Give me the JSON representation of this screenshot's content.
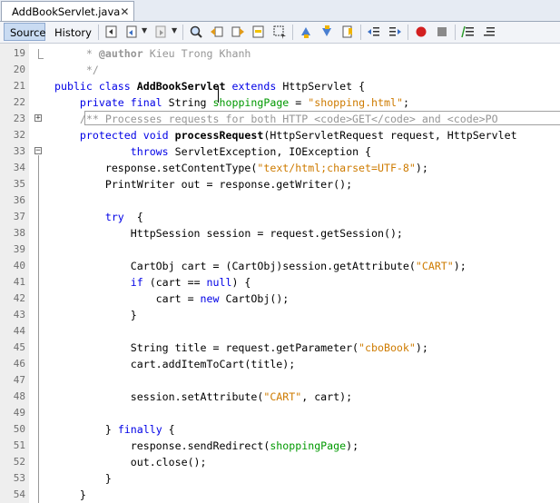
{
  "tab": {
    "title": "AddBookServlet.java",
    "close": "✕"
  },
  "toolbar": {
    "source_label": "Source",
    "history_label": "History",
    "icons": [
      "last-edit-icon",
      "back-icon",
      "forward-icon",
      "find-icon",
      "find-previous-icon",
      "find-next-icon",
      "toggle-highlight-icon",
      "toggle-rectangular-selection-icon",
      "previous-bookmark-icon",
      "next-bookmark-icon",
      "toggle-bookmark-icon",
      "shift-left-icon",
      "shift-right-icon",
      "start-macro-icon",
      "stop-macro-icon",
      "comment-icon",
      "uncomment-icon"
    ]
  },
  "lines": [
    {
      "n": "19",
      "segs": [
        [
          "cm",
          "     * "
        ],
        [
          "cmtag",
          "@author"
        ],
        [
          "cm",
          " Kieu Trong Khanh"
        ]
      ]
    },
    {
      "n": "20",
      "segs": [
        [
          "cm",
          "     */"
        ]
      ]
    },
    {
      "n": "21",
      "segs": [
        [
          "kw",
          "public class "
        ],
        [
          "bold",
          "AddBookServlet"
        ],
        [
          "kw",
          " extends "
        ],
        [
          "",
          "HttpServlet {"
        ]
      ]
    },
    {
      "n": "22",
      "segs": [
        [
          "",
          "    "
        ],
        [
          "kw",
          "private final "
        ],
        [
          "",
          "String "
        ],
        [
          "fld",
          "shoppingPage"
        ],
        [
          "",
          " = "
        ],
        [
          "str",
          "\"shopping.html\""
        ],
        [
          "",
          ";"
        ]
      ]
    },
    {
      "n": "23",
      "segs": [
        [
          "cm",
          "    /** Processes requests for both HTTP <code>GET</code> and <code>PO"
        ]
      ]
    },
    {
      "n": "32",
      "segs": [
        [
          "",
          "    "
        ],
        [
          "kw",
          "protected void "
        ],
        [
          "bold",
          "processRequest"
        ],
        [
          "",
          "(HttpServletRequest request, HttpServlet"
        ]
      ]
    },
    {
      "n": "33",
      "segs": [
        [
          "",
          "            "
        ],
        [
          "kw",
          "throws "
        ],
        [
          "",
          "ServletException, IOException {"
        ]
      ]
    },
    {
      "n": "34",
      "segs": [
        [
          "",
          "        response.setContentType("
        ],
        [
          "str",
          "\"text/html;charset=UTF-8\""
        ],
        [
          "",
          ");"
        ]
      ]
    },
    {
      "n": "35",
      "segs": [
        [
          "",
          "        PrintWriter out = response.getWriter();"
        ]
      ]
    },
    {
      "n": "36",
      "segs": []
    },
    {
      "n": "37",
      "segs": [
        [
          "",
          "        "
        ],
        [
          "kw",
          "try"
        ],
        [
          "",
          "  {"
        ]
      ]
    },
    {
      "n": "38",
      "segs": [
        [
          "",
          "            HttpSession session = request.getSession();"
        ]
      ]
    },
    {
      "n": "39",
      "segs": []
    },
    {
      "n": "40",
      "segs": [
        [
          "",
          "            CartObj cart = (CartObj)session.getAttribute("
        ],
        [
          "str",
          "\"CART\""
        ],
        [
          "",
          ");"
        ]
      ]
    },
    {
      "n": "41",
      "segs": [
        [
          "",
          "            "
        ],
        [
          "kw",
          "if"
        ],
        [
          "",
          " (cart == "
        ],
        [
          "kw",
          "null"
        ],
        [
          "",
          ") {"
        ]
      ]
    },
    {
      "n": "42",
      "segs": [
        [
          "",
          "                cart = "
        ],
        [
          "kw",
          "new"
        ],
        [
          "",
          " CartObj();"
        ]
      ]
    },
    {
      "n": "43",
      "segs": [
        [
          "",
          "            }"
        ]
      ]
    },
    {
      "n": "44",
      "segs": []
    },
    {
      "n": "45",
      "segs": [
        [
          "",
          "            String title = request.getParameter("
        ],
        [
          "str",
          "\"cboBook\""
        ],
        [
          "",
          ");"
        ]
      ]
    },
    {
      "n": "46",
      "segs": [
        [
          "",
          "            cart.addItemToCart(title);"
        ]
      ]
    },
    {
      "n": "47",
      "segs": []
    },
    {
      "n": "48",
      "segs": [
        [
          "",
          "            session.setAttribute("
        ],
        [
          "str",
          "\"CART\""
        ],
        [
          "",
          ", cart);"
        ]
      ]
    },
    {
      "n": "49",
      "segs": []
    },
    {
      "n": "50",
      "segs": [
        [
          "",
          "        } "
        ],
        [
          "kw",
          "finally"
        ],
        [
          "",
          " {"
        ]
      ]
    },
    {
      "n": "51",
      "segs": [
        [
          "",
          "            response.sendRedirect("
        ],
        [
          "fld",
          "shoppingPage"
        ],
        [
          "",
          ");"
        ]
      ]
    },
    {
      "n": "52",
      "segs": [
        [
          "",
          "            out.close();"
        ]
      ]
    },
    {
      "n": "53",
      "segs": [
        [
          "",
          "        }"
        ]
      ]
    },
    {
      "n": "54",
      "segs": [
        [
          "",
          "    }"
        ]
      ]
    }
  ]
}
